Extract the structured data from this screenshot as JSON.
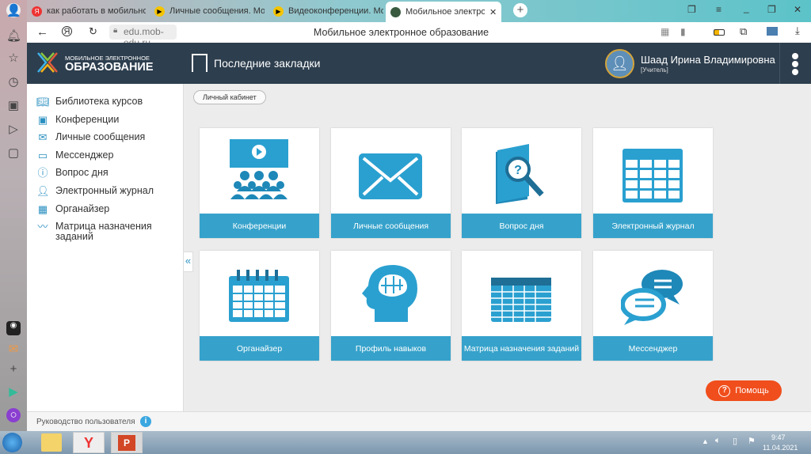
{
  "browser": {
    "tabs": [
      {
        "label": "как работать в мобильно"
      },
      {
        "label": "Личные сообщения. Моб"
      },
      {
        "label": "Видеоконференции. Моб"
      },
      {
        "label": "Мобильное электронно"
      }
    ],
    "url": "edu.mob-edu.ru",
    "page_title": "Мобильное электронное образование"
  },
  "header": {
    "logo_top": "МОБИЛЬНОЕ ЭЛЕКТРОННОЕ",
    "logo_bottom": "ОБРАЗОВАНИЕ",
    "bookmarks": "Последние закладки",
    "user_name": "Шаад Ирина Владимировна",
    "user_role": "[Учитель]"
  },
  "sidebar": {
    "items": [
      {
        "label": "Библиотека курсов",
        "icon": "book-icon"
      },
      {
        "label": "Конференции",
        "icon": "video-icon"
      },
      {
        "label": "Личные сообщения",
        "icon": "mail-icon"
      },
      {
        "label": "Мессенджер",
        "icon": "chat-icon"
      },
      {
        "label": "Вопрос дня",
        "icon": "question-icon"
      },
      {
        "label": "Электронный журнал",
        "icon": "journal-icon"
      },
      {
        "label": "Органайзер",
        "icon": "calendar-icon"
      },
      {
        "label": "Матрица назначения заданий",
        "icon": "chart-icon"
      }
    ]
  },
  "breadcrumb": "Личный кабинет",
  "tiles": [
    {
      "label": "Конференции"
    },
    {
      "label": "Личные сообщения"
    },
    {
      "label": "Вопрос дня"
    },
    {
      "label": "Электронный журнал"
    },
    {
      "label": "Органайзер"
    },
    {
      "label": "Профиль навыков"
    },
    {
      "label": "Матрица назначения заданий"
    },
    {
      "label": "Мессенджер"
    }
  ],
  "help": "Помощь",
  "footer": "Руководство пользователя",
  "clock": {
    "time": "9:47",
    "date": "11.04.2021"
  },
  "colors": {
    "accent": "#36a2cb",
    "header": "#2d3e4e",
    "help": "#f04e1c"
  }
}
